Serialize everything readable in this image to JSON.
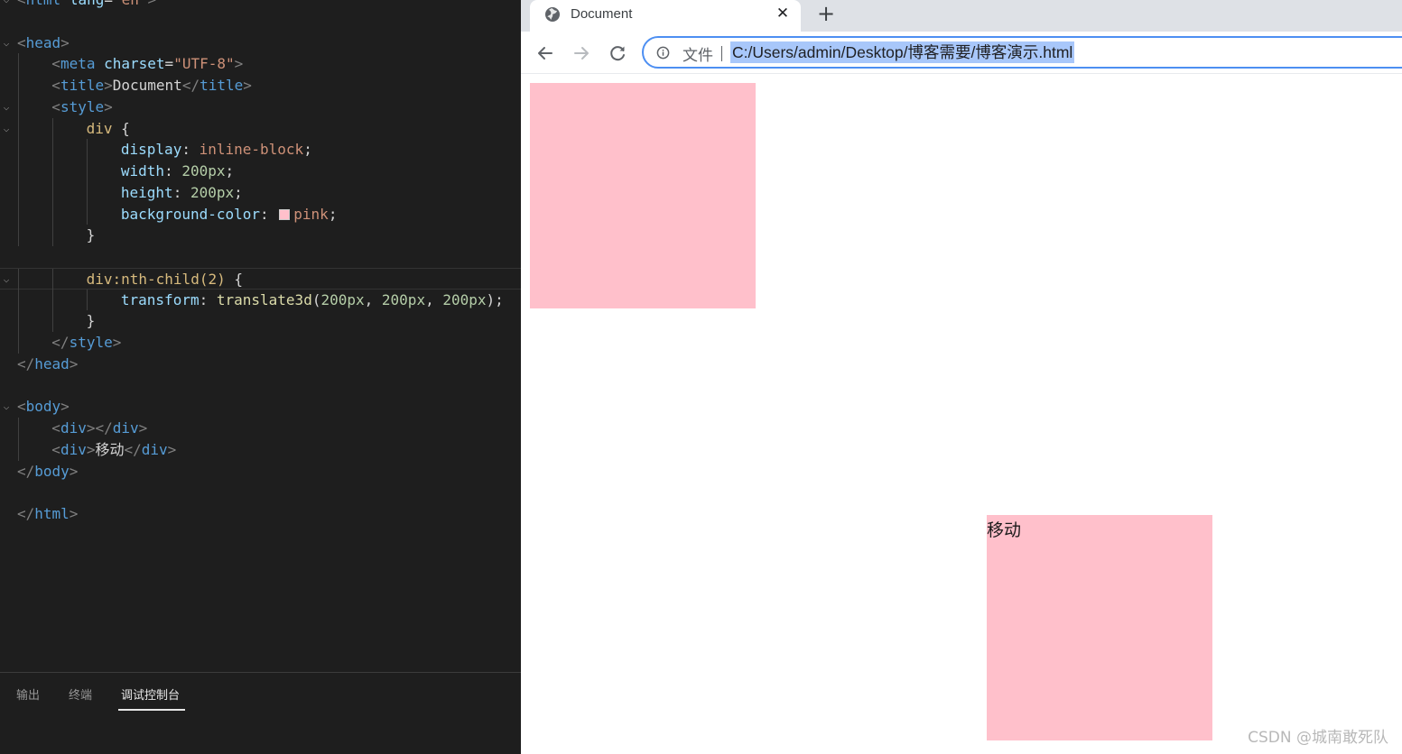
{
  "editor": {
    "lines": [
      [
        [
          "t-p",
          "<"
        ],
        [
          "t-tag",
          "html"
        ],
        [
          "t-tx",
          " "
        ],
        [
          "t-at",
          "lang"
        ],
        [
          "t-tx",
          "="
        ],
        [
          "t-str",
          "\"en\""
        ],
        [
          "t-p",
          ">"
        ]
      ],
      [],
      [
        [
          "t-p",
          "<"
        ],
        [
          "t-tag",
          "head"
        ],
        [
          "t-p",
          ">"
        ]
      ],
      [
        [
          "t-p",
          "<"
        ],
        [
          "t-tag",
          "meta"
        ],
        [
          "t-tx",
          " "
        ],
        [
          "t-at",
          "charset"
        ],
        [
          "t-tx",
          "="
        ],
        [
          "t-str",
          "\"UTF-8\""
        ],
        [
          "t-p",
          ">"
        ]
      ],
      [
        [
          "t-p",
          "<"
        ],
        [
          "t-tag",
          "title"
        ],
        [
          "t-p",
          ">"
        ],
        [
          "t-tx",
          "Document"
        ],
        [
          "t-p",
          "</"
        ],
        [
          "t-tag",
          "title"
        ],
        [
          "t-p",
          ">"
        ]
      ],
      [
        [
          "t-p",
          "<"
        ],
        [
          "t-tag",
          "style"
        ],
        [
          "t-p",
          ">"
        ]
      ],
      [
        [
          "t-sel",
          "div"
        ],
        [
          "t-tx",
          " {"
        ]
      ],
      [
        [
          "t-prop",
          "display"
        ],
        [
          "t-tx",
          ": "
        ],
        [
          "t-val",
          "inline-block"
        ],
        [
          "t-tx",
          ";"
        ]
      ],
      [
        [
          "t-prop",
          "width"
        ],
        [
          "t-tx",
          ": "
        ],
        [
          "t-num",
          "200px"
        ],
        [
          "t-tx",
          ";"
        ]
      ],
      [
        [
          "t-prop",
          "height"
        ],
        [
          "t-tx",
          ": "
        ],
        [
          "t-num",
          "200px"
        ],
        [
          "t-tx",
          ";"
        ]
      ],
      [
        [
          "t-prop",
          "background-color"
        ],
        [
          "t-tx",
          ": "
        ],
        [
          "swatch",
          "#ffc0cb"
        ],
        [
          "t-val",
          "pink"
        ],
        [
          "t-tx",
          ";"
        ]
      ],
      [
        [
          "t-tx",
          "}"
        ]
      ],
      [],
      [
        [
          "t-sel",
          "div:nth-child(2)"
        ],
        [
          "t-tx",
          " {"
        ]
      ],
      [
        [
          "t-prop",
          "transform"
        ],
        [
          "t-tx",
          ": "
        ],
        [
          "t-fn",
          "translate3d"
        ],
        [
          "t-tx",
          "("
        ],
        [
          "t-num",
          "200px"
        ],
        [
          "t-tx",
          ", "
        ],
        [
          "t-num",
          "200px"
        ],
        [
          "t-tx",
          ", "
        ],
        [
          "t-num",
          "200px"
        ],
        [
          "t-tx",
          ");"
        ]
      ],
      [
        [
          "t-tx",
          "}"
        ]
      ],
      [
        [
          "t-p",
          "</"
        ],
        [
          "t-tag",
          "style"
        ],
        [
          "t-p",
          ">"
        ]
      ],
      [
        [
          "t-p",
          "</"
        ],
        [
          "t-tag",
          "head"
        ],
        [
          "t-p",
          ">"
        ]
      ],
      [],
      [
        [
          "t-p",
          "<"
        ],
        [
          "t-tag",
          "body"
        ],
        [
          "t-p",
          ">"
        ]
      ],
      [
        [
          "t-p",
          "<"
        ],
        [
          "t-tag",
          "div"
        ],
        [
          "t-p",
          "></"
        ],
        [
          "t-tag",
          "div"
        ],
        [
          "t-p",
          ">"
        ]
      ],
      [
        [
          "t-p",
          "<"
        ],
        [
          "t-tag",
          "div"
        ],
        [
          "t-p",
          ">"
        ],
        [
          "t-tx",
          "移动"
        ],
        [
          "t-p",
          "</"
        ],
        [
          "t-tag",
          "div"
        ],
        [
          "t-p",
          ">"
        ]
      ],
      [
        [
          "t-p",
          "</"
        ],
        [
          "t-tag",
          "body"
        ],
        [
          "t-p",
          ">"
        ]
      ],
      [],
      [
        [
          "t-p",
          "</"
        ],
        [
          "t-tag",
          "html"
        ],
        [
          "t-p",
          ">"
        ]
      ]
    ]
  },
  "panel": {
    "tabs": [
      {
        "label": "输出",
        "active": false
      },
      {
        "label": "终端",
        "active": false
      },
      {
        "label": "调试控制台",
        "active": true
      }
    ]
  },
  "browser": {
    "tab_title": "Document",
    "tab_close_glyph": "✕",
    "new_tab_glyph": "+",
    "file_label": "文件",
    "url": "C:/Users/admin/Desktop/博客需要/博客演示.html",
    "page": {
      "box_color": "#ffc0cb",
      "second_box_text": "移动",
      "watermark": "CSDN @城南敢死队"
    }
  }
}
